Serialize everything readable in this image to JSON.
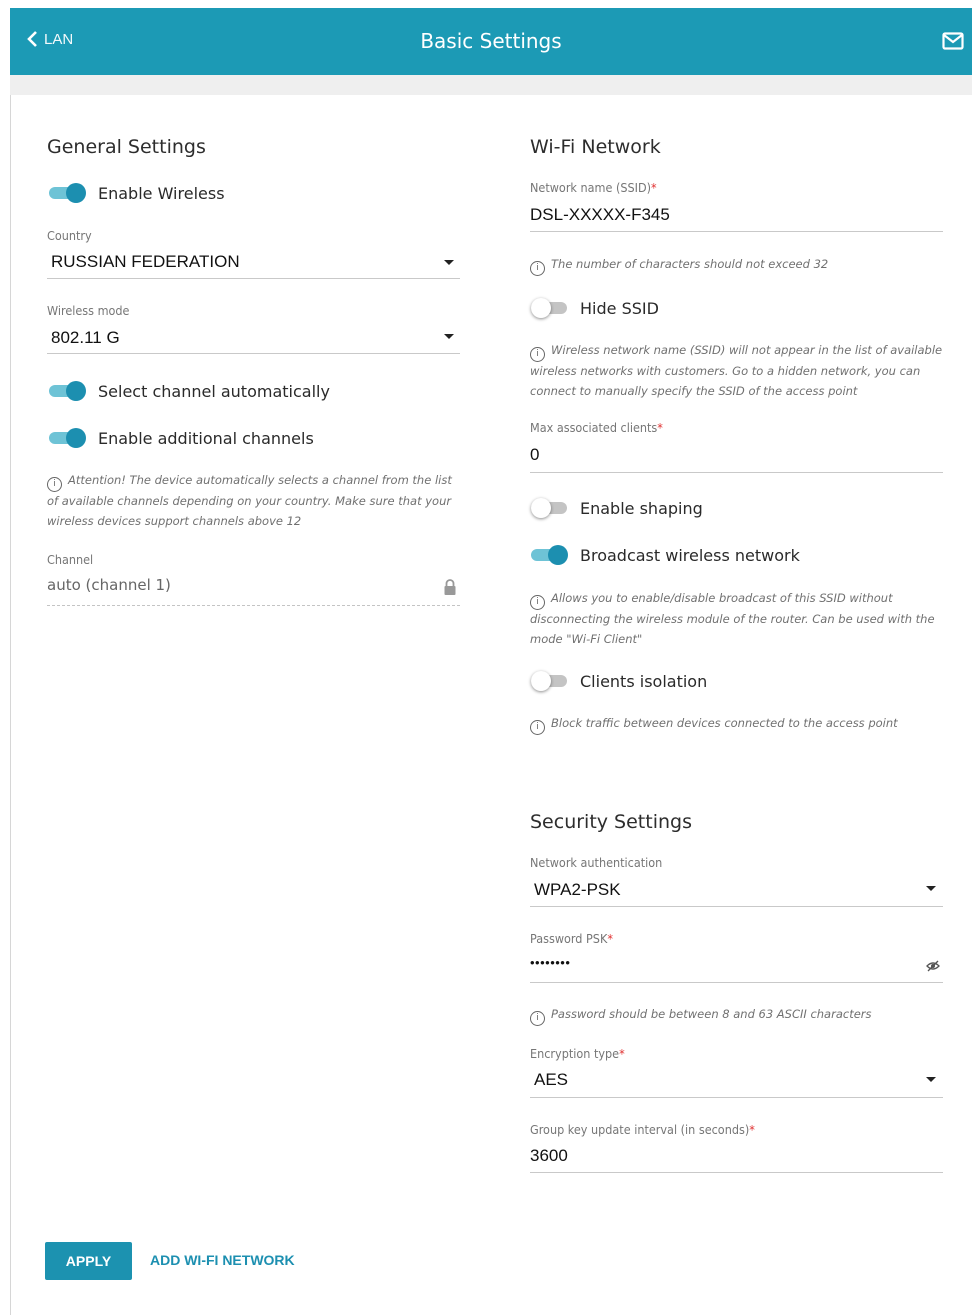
{
  "header": {
    "back_label": "LAN",
    "title": "Basic Settings"
  },
  "general": {
    "title": "General Settings",
    "enable_wireless": {
      "label": "Enable Wireless",
      "on": true
    },
    "country": {
      "label": "Country",
      "value": "RUSSIAN FEDERATION"
    },
    "wireless_mode": {
      "label": "Wireless mode",
      "value": "802.11 G"
    },
    "auto_channel": {
      "label": "Select channel automatically",
      "on": true
    },
    "additional_channels": {
      "label": "Enable additional channels",
      "on": true
    },
    "attention_hint": "Attention! The device automatically selects a channel from the list of available channels depending on your country. Make sure that your wireless devices support channels above 12",
    "channel": {
      "label": "Channel",
      "value": "auto (channel 1)"
    }
  },
  "wifi": {
    "title": "Wi-Fi Network",
    "ssid": {
      "label": "Network name (SSID)",
      "value": "DSL-XXXXX-F345"
    },
    "ssid_hint": "The number of characters should not exceed 32",
    "hide_ssid": {
      "label": "Hide SSID",
      "on": false
    },
    "hide_ssid_hint": "Wireless network name (SSID) will not appear in the list of available wireless networks with customers. Go to a hidden network, you can connect to manually specify the SSID of the access point",
    "max_clients": {
      "label": "Max associated clients",
      "value": "0"
    },
    "shaping": {
      "label": "Enable shaping",
      "on": false
    },
    "broadcast": {
      "label": "Broadcast wireless network",
      "on": true
    },
    "broadcast_hint": "Allows you to enable/disable broadcast of this SSID without disconnecting the wireless module of the router. Can be used with the mode \"Wi-Fi Client\"",
    "isolation": {
      "label": "Clients isolation",
      "on": false
    },
    "isolation_hint": "Block traffic between devices connected to the access point"
  },
  "security": {
    "title": "Security Settings",
    "auth": {
      "label": "Network authentication",
      "value": "WPA2-PSK"
    },
    "psk": {
      "label": "Password PSK",
      "value": "••••••••"
    },
    "psk_hint": "Password should be between 8 and 63 ASCII characters",
    "encryption": {
      "label": "Encryption type",
      "value": "AES"
    },
    "group_key": {
      "label": "Group key update interval (in seconds)",
      "value": "3600"
    }
  },
  "actions": {
    "apply": "APPLY",
    "add_network": "ADD WI-FI NETWORK"
  },
  "colors": {
    "accent": "#1c9ab5",
    "toggle_on": "#1c8fb0",
    "required": "#e03030"
  }
}
